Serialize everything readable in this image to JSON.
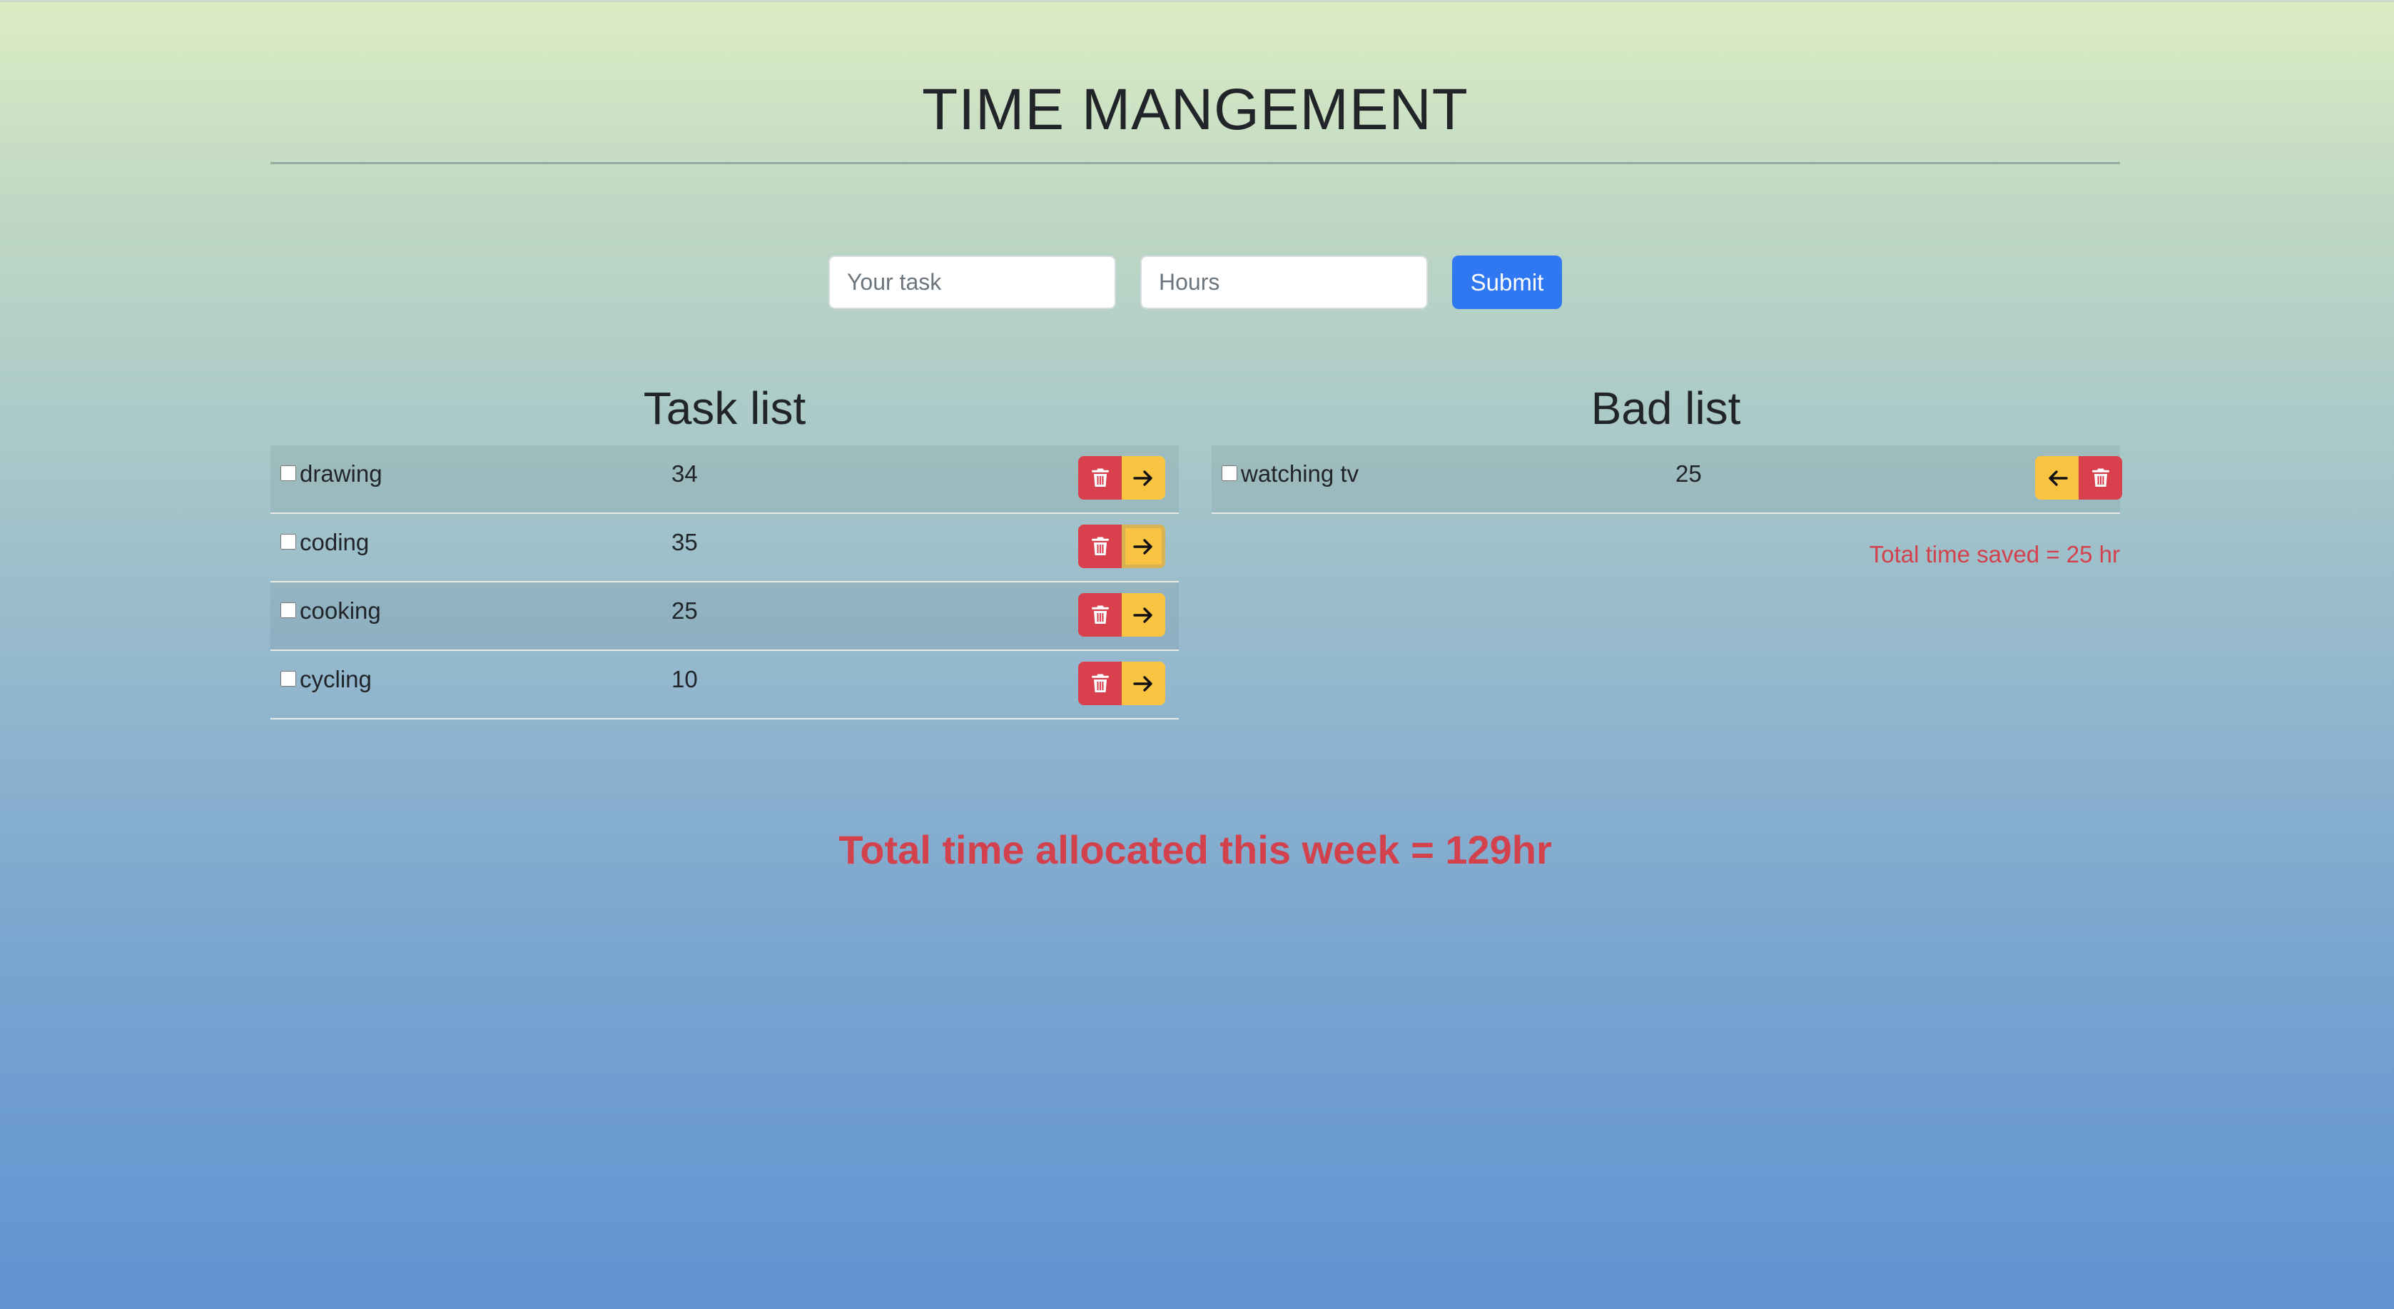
{
  "page": {
    "title": "TIME MANGEMENT"
  },
  "form": {
    "task_placeholder": "Your task",
    "hours_placeholder": "Hours",
    "submit_label": "Submit"
  },
  "task_list": {
    "title": "Task list",
    "rows": [
      {
        "name": "drawing",
        "hours": "34"
      },
      {
        "name": "coding",
        "hours": "35"
      },
      {
        "name": "cooking",
        "hours": "25"
      },
      {
        "name": "cycling",
        "hours": "10"
      }
    ]
  },
  "bad_list": {
    "title": "Bad list",
    "rows": [
      {
        "name": "watching tv",
        "hours": "25"
      }
    ],
    "total_saved": "Total time saved = 25 hr"
  },
  "summary": {
    "total_allocated": "Total time allocated this week = 129hr"
  },
  "icons": {
    "delete": "trash-icon",
    "move_right": "arrow-right-icon",
    "move_left": "arrow-left-icon"
  },
  "colors": {
    "danger": "#d9404d",
    "warning": "#f8c441",
    "primary": "#2f78f2",
    "total_text": "#d3414d"
  }
}
